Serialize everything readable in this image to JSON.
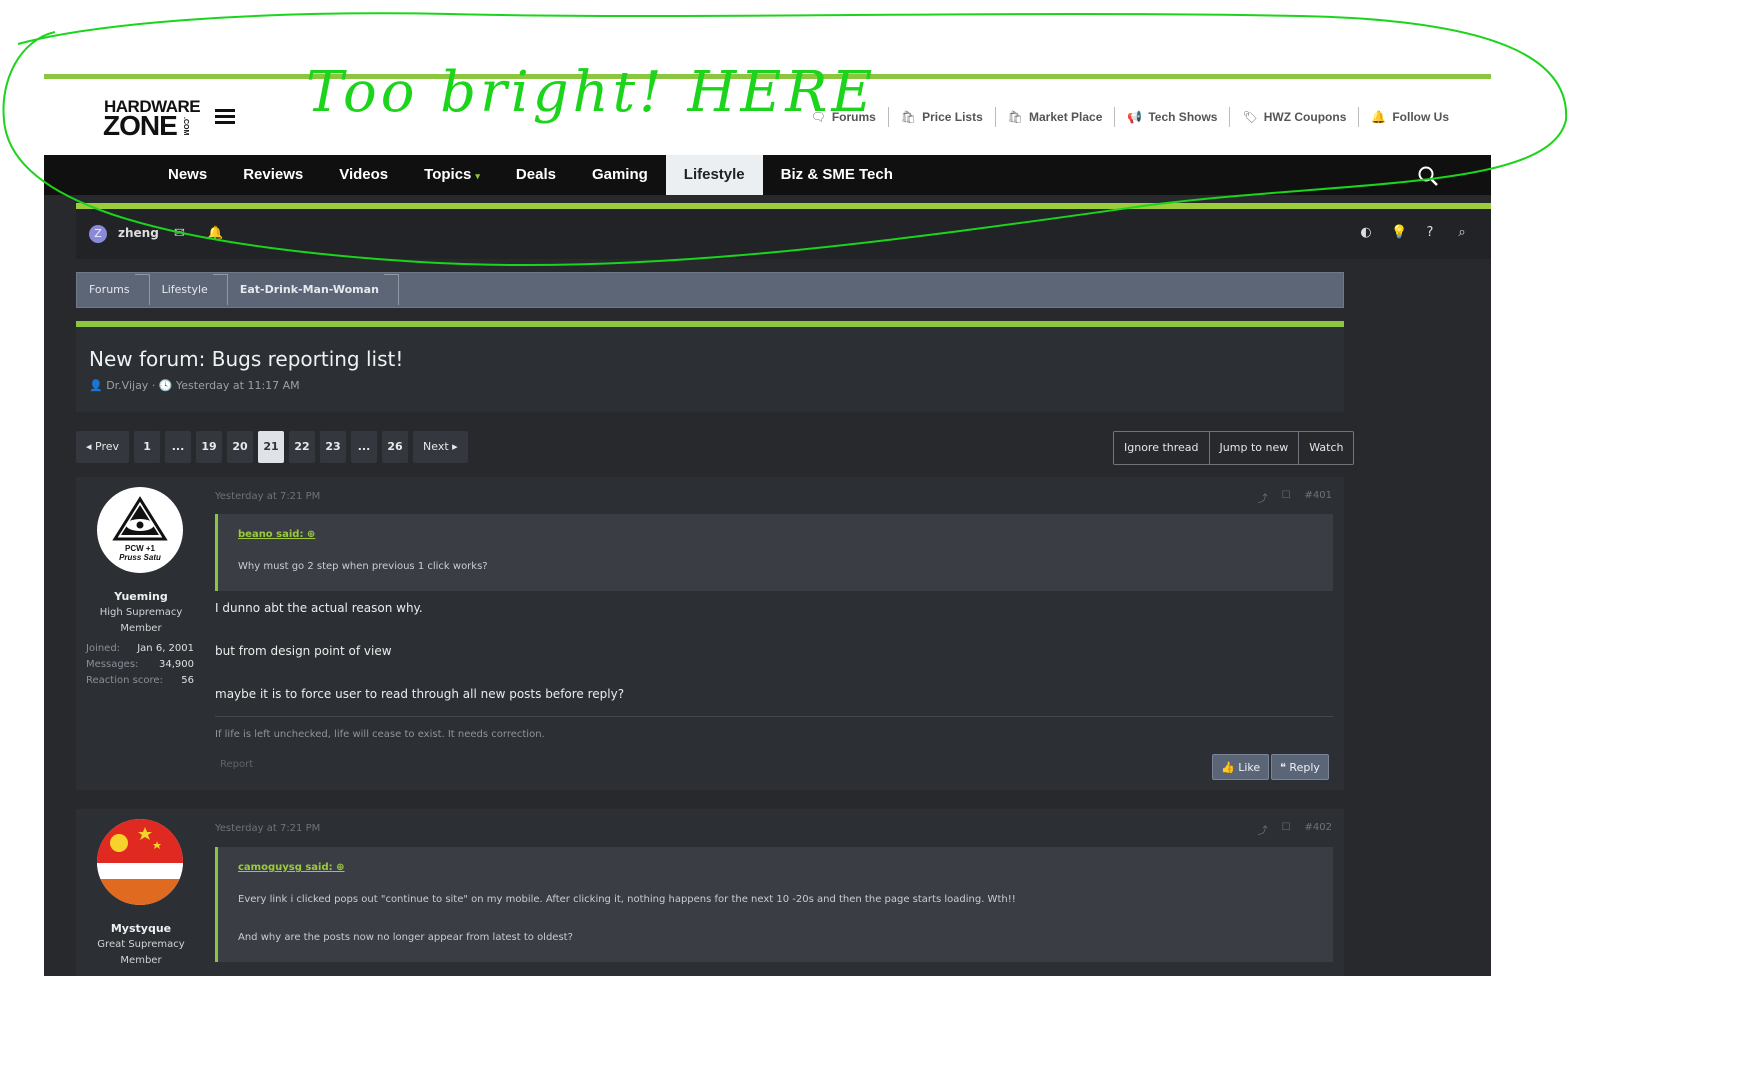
{
  "logo": {
    "line1": "HARDWARE",
    "line2": "ZONE",
    "line3": ".COM"
  },
  "top_links": [
    {
      "label": "Forums",
      "icon": "chat-icon",
      "glyph": "🗨"
    },
    {
      "label": "Price Lists",
      "icon": "shopping-bag-icon",
      "glyph": "🛍"
    },
    {
      "label": "Market Place",
      "icon": "shopping-bag-icon",
      "glyph": "🛍"
    },
    {
      "label": "Tech Shows",
      "icon": "megaphone-icon",
      "glyph": "📢"
    },
    {
      "label": "HWZ Coupons",
      "icon": "tag-icon",
      "glyph": "🏷"
    },
    {
      "label": "Follow Us",
      "icon": "bell-icon",
      "glyph": "🔔"
    }
  ],
  "main_nav": [
    {
      "label": "News"
    },
    {
      "label": "Reviews"
    },
    {
      "label": "Videos"
    },
    {
      "label": "Topics",
      "caret": "▾"
    },
    {
      "label": "Deals"
    },
    {
      "label": "Gaming"
    },
    {
      "label": "Lifestyle",
      "active": true
    },
    {
      "label": "Biz & SME Tech"
    }
  ],
  "user_bar": {
    "avatar_letter": "Z",
    "username": "zheng"
  },
  "breadcrumb": [
    "Forums",
    "Lifestyle",
    "Eat-Drink-Man-Woman"
  ],
  "thread": {
    "title": "New forum: Bugs reporting list!",
    "meta": "👤 Dr.Vijay · 🕓 Yesterday at 11:17 AM"
  },
  "pagination": [
    "◂ Prev",
    "1",
    "...",
    "19",
    "20",
    "21",
    "22",
    "23",
    "...",
    "26",
    "Next ▸"
  ],
  "pagination_current": "21",
  "thread_actions": [
    "Ignore thread",
    "Jump to new",
    "Watch"
  ],
  "posts": [
    {
      "author": "Yueming",
      "user_title": "High Supremacy Member",
      "avatar_text": [
        "PCW +1",
        "Pruss Satu"
      ],
      "joined_label": "Joined:",
      "joined": "Jan 6, 2001",
      "messages_label": "Messages:",
      "messages": "34,900",
      "reaction_label": "Reaction score:",
      "reaction": "56",
      "date": "Yesterday at 7:21 PM",
      "number": "#401",
      "quote_author": "beano said: ⊕",
      "quote_lines": [
        "Why must go 2 step when previous 1 click works?"
      ],
      "body": [
        "I dunno abt the actual reason why.",
        "but from design point of view",
        "maybe it is to force user to read through all new posts before reply?"
      ],
      "signature": "If life is left unchecked, life will cease to exist. It needs correction.",
      "report": "Report",
      "like": "👍 Like",
      "reply": "❝ Reply"
    },
    {
      "author": "Mystyque",
      "user_title": "Great Supremacy Member",
      "date": "Yesterday at 7:21 PM",
      "number": "#402",
      "quote_author": "camoguysg said: ⊕",
      "quote_lines": [
        "Every link i clicked pops out \"continue to site\" on my mobile. After clicking it, nothing happens for the next 10 -20s and then the page starts loading. Wth!!",
        "And why are the posts now no longer appear from latest to oldest?"
      ]
    }
  ],
  "annotation": {
    "text": "Too bright! HERE",
    "color": "#1bd41b"
  }
}
